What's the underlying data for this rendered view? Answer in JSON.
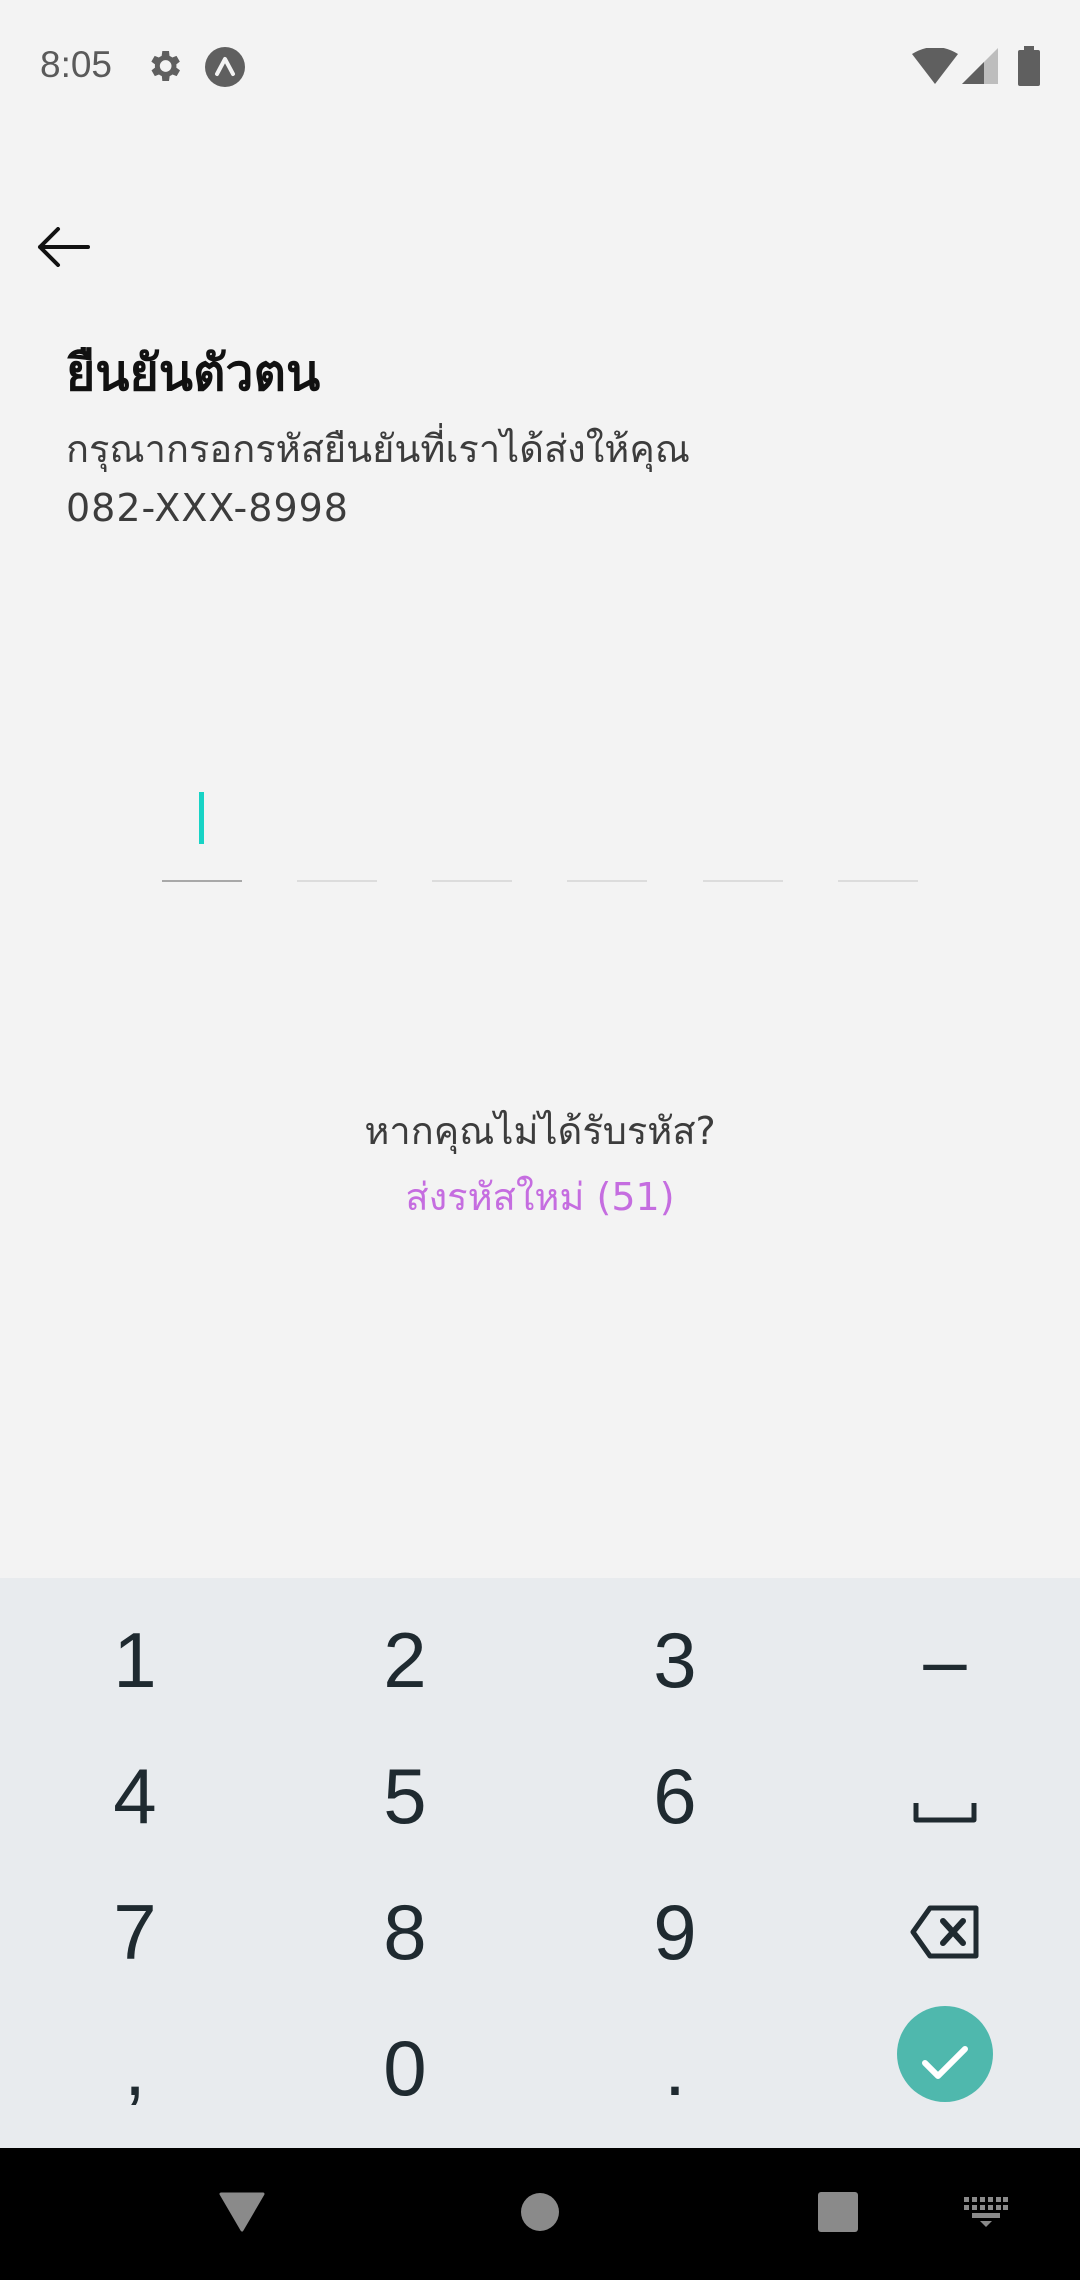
{
  "status_bar": {
    "time": "8:05",
    "icons": [
      "gear-icon",
      "app-notification-icon",
      "wifi-icon",
      "cell-signal-icon",
      "battery-icon"
    ]
  },
  "header": {
    "back_icon": "arrow-left-icon",
    "title": "ยืนยันตัวตน",
    "subtitle": "กรุณากรอกรหัสยืนยันที่เราได้ส่งให้คุณ",
    "phone": "082-XXX-8998"
  },
  "otp": {
    "length": 6,
    "values": [
      "",
      "",
      "",
      "",
      "",
      ""
    ],
    "active_index": 0
  },
  "resend": {
    "question": "หากคุณไม่ได้รับรหัส?",
    "label": "ส่งรหัสใหม่ (51)"
  },
  "keyboard": {
    "keys": [
      [
        "1",
        "2",
        "3",
        "–"
      ],
      [
        "4",
        "5",
        "6",
        "space-icon"
      ],
      [
        "7",
        "8",
        "9",
        "backspace-icon"
      ],
      [
        ",",
        "0",
        ".",
        "confirm-icon"
      ]
    ]
  },
  "nav_bar": {
    "icons": [
      "back-triangle-icon",
      "home-circle-icon",
      "recents-square-icon",
      "keyboard-switch-icon"
    ]
  },
  "colors": {
    "background": "#f3f3f3",
    "accent_cursor": "#17d3c5",
    "resend_link": "#c56de0",
    "keyboard_bg": "#e8ebee",
    "confirm_key": "#4fb8ad"
  }
}
